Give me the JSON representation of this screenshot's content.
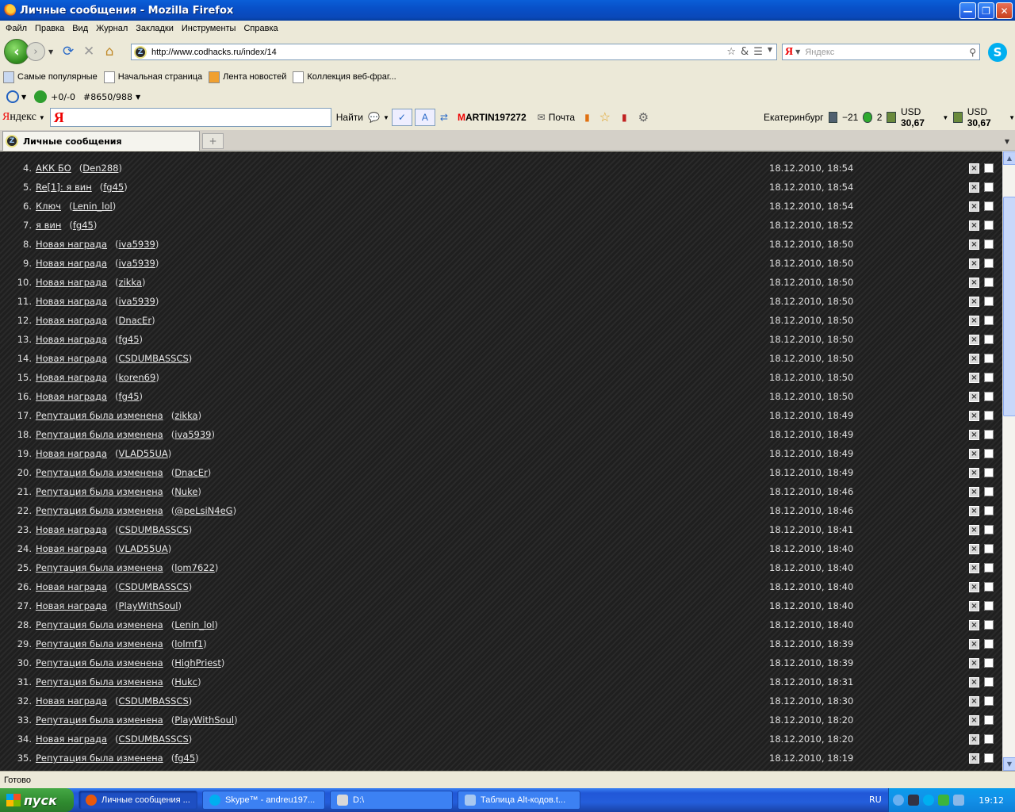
{
  "window": {
    "title": "Личные сообщения - Mozilla Firefox"
  },
  "menu": [
    "Файл",
    "Правка",
    "Вид",
    "Журнал",
    "Закладки",
    "Инструменты",
    "Справка"
  ],
  "nav": {
    "url": "http://www.codhacks.ru/index/14",
    "search_placeholder": "Яндекс"
  },
  "bookmarks": [
    "Самые популярные",
    "Начальная страница",
    "Лента новостей",
    "Коллекция веб-фраг..."
  ],
  "addon": {
    "counter": "+0/-0",
    "id_label": "#8650/988"
  },
  "yandex_bar": {
    "logo_prefix": "Я",
    "logo_suffix": "ндекс",
    "find_label": "Найти",
    "user_initial": "M",
    "user_rest": "ARTIN197272",
    "mail_label": "Почта",
    "city": "Екатеринбург",
    "temperature": "−21",
    "traffic": "2",
    "usd_label_1": "USD",
    "usd_value_1": "30,67",
    "usd_label_2": "USD",
    "usd_value_2": "30,67"
  },
  "tab": {
    "label": "Личные сообщения"
  },
  "messages": [
    {
      "num": "4.",
      "subject": "АКК БО",
      "author": "Den288",
      "date": "18.12.2010, 18:54"
    },
    {
      "num": "5.",
      "subject": "Re[1]: я вин",
      "author": "fg45",
      "date": "18.12.2010, 18:54"
    },
    {
      "num": "6.",
      "subject": "Ключ",
      "author": "Lenin_lol",
      "date": "18.12.2010, 18:54"
    },
    {
      "num": "7.",
      "subject": "я вин",
      "author": "fg45",
      "date": "18.12.2010, 18:52"
    },
    {
      "num": "8.",
      "subject": "Новая награда",
      "author": "iva5939",
      "date": "18.12.2010, 18:50"
    },
    {
      "num": "9.",
      "subject": "Новая награда",
      "author": "iva5939",
      "date": "18.12.2010, 18:50"
    },
    {
      "num": "10.",
      "subject": "Новая награда",
      "author": "zikka",
      "date": "18.12.2010, 18:50"
    },
    {
      "num": "11.",
      "subject": "Новая награда",
      "author": "iva5939",
      "date": "18.12.2010, 18:50"
    },
    {
      "num": "12.",
      "subject": "Новая награда",
      "author": "DnacEr",
      "date": "18.12.2010, 18:50"
    },
    {
      "num": "13.",
      "subject": "Новая награда",
      "author": "fg45",
      "date": "18.12.2010, 18:50"
    },
    {
      "num": "14.",
      "subject": "Новая награда",
      "author": "CSDUMBASSCS",
      "date": "18.12.2010, 18:50"
    },
    {
      "num": "15.",
      "subject": "Новая награда",
      "author": "koren69",
      "date": "18.12.2010, 18:50"
    },
    {
      "num": "16.",
      "subject": "Новая награда",
      "author": "fg45",
      "date": "18.12.2010, 18:50"
    },
    {
      "num": "17.",
      "subject": "Репутация была изменена",
      "author": "zikka",
      "date": "18.12.2010, 18:49"
    },
    {
      "num": "18.",
      "subject": "Репутация была изменена",
      "author": "iva5939",
      "date": "18.12.2010, 18:49"
    },
    {
      "num": "19.",
      "subject": "Новая награда",
      "author": "VLAD55UA",
      "date": "18.12.2010, 18:49"
    },
    {
      "num": "20.",
      "subject": "Репутация была изменена",
      "author": "DnacEr",
      "date": "18.12.2010, 18:49"
    },
    {
      "num": "21.",
      "subject": "Репутация была изменена",
      "author": "Nuke",
      "date": "18.12.2010, 18:46"
    },
    {
      "num": "22.",
      "subject": "Репутация была изменена",
      "author": "@peLsiN4eG",
      "date": "18.12.2010, 18:46"
    },
    {
      "num": "23.",
      "subject": "Новая награда",
      "author": "CSDUMBASSCS",
      "date": "18.12.2010, 18:41"
    },
    {
      "num": "24.",
      "subject": "Новая награда",
      "author": "VLAD55UA",
      "date": "18.12.2010, 18:40"
    },
    {
      "num": "25.",
      "subject": "Репутация была изменена",
      "author": "lom7622",
      "date": "18.12.2010, 18:40"
    },
    {
      "num": "26.",
      "subject": "Новая награда",
      "author": "CSDUMBASSCS",
      "date": "18.12.2010, 18:40"
    },
    {
      "num": "27.",
      "subject": "Новая награда",
      "author": "PlayWithSoul",
      "date": "18.12.2010, 18:40"
    },
    {
      "num": "28.",
      "subject": "Репутация была изменена",
      "author": "Lenin_lol",
      "date": "18.12.2010, 18:40"
    },
    {
      "num": "29.",
      "subject": "Репутация была изменена",
      "author": "lolmf1",
      "date": "18.12.2010, 18:39"
    },
    {
      "num": "30.",
      "subject": "Репутация была изменена",
      "author": "HighPriest",
      "date": "18.12.2010, 18:39"
    },
    {
      "num": "31.",
      "subject": "Репутация была изменена",
      "author": "Hukc",
      "date": "18.12.2010, 18:31"
    },
    {
      "num": "32.",
      "subject": "Новая награда",
      "author": "CSDUMBASSCS",
      "date": "18.12.2010, 18:30"
    },
    {
      "num": "33.",
      "subject": "Репутация была изменена",
      "author": "PlayWithSoul",
      "date": "18.12.2010, 18:20"
    },
    {
      "num": "34.",
      "subject": "Новая награда",
      "author": "CSDUMBASSCS",
      "date": "18.12.2010, 18:20"
    },
    {
      "num": "35.",
      "subject": "Репутация была изменена",
      "author": "fg45",
      "date": "18.12.2010, 18:19"
    }
  ],
  "status": {
    "text": "Готово"
  },
  "taskbar": {
    "start_label": "пуск",
    "tasks": [
      "Личные сообщения ...",
      "Skype™ - andreu197...",
      "D:\\",
      "Таблица Alt-кодов.t..."
    ],
    "lang": "RU",
    "clock": "19:12"
  },
  "colors": {
    "titlebar": "#0a5fd8",
    "content_bg": "#232323",
    "start_green": "#2f8a2f",
    "accent_red": "#e00000"
  }
}
